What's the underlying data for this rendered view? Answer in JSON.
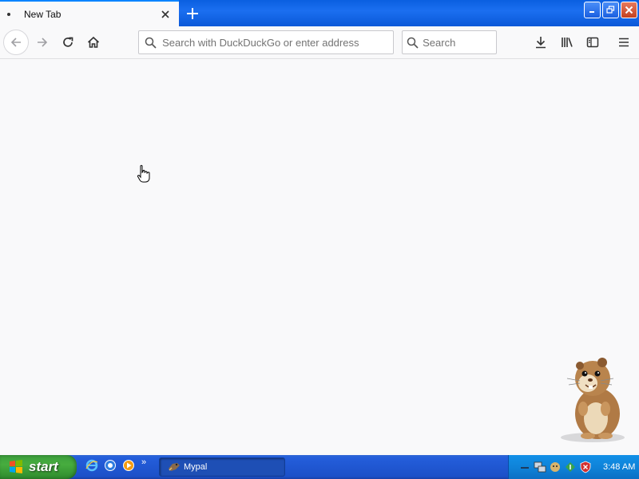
{
  "tab": {
    "title": "New Tab",
    "close_icon": "close-icon",
    "new_tab_icon": "plus-icon"
  },
  "window_controls": [
    "minimize",
    "restore",
    "close"
  ],
  "toolbar": {
    "url_placeholder": "Search with DuckDuckGo or enter address",
    "search_placeholder": "Search",
    "icons": [
      "back-arrow-icon",
      "forward-arrow-icon",
      "reload-icon",
      "home-icon",
      "download-icon",
      "library-icon",
      "sidebar-icon",
      "menu-icon"
    ]
  },
  "taskbar": {
    "start_label": "start",
    "task_label": "Mypal",
    "quick_launch_chevron": "»",
    "clock": "3:48 AM"
  },
  "colors": {
    "accent": "#0a84ff",
    "taskbar_blue": "#245edb",
    "start_green": "#3c9e3c",
    "tray_blue": "#0f83d9"
  }
}
